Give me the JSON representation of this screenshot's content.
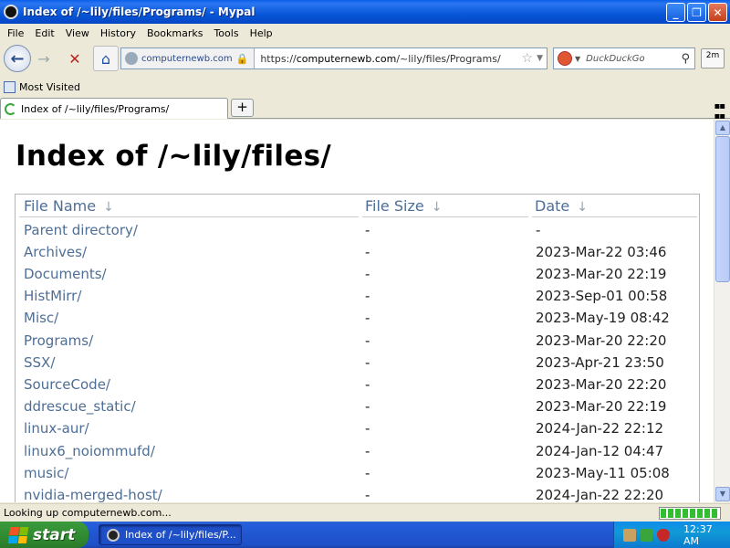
{
  "window": {
    "title": "Index of /~lily/files/Programs/ - Mypal",
    "min_label": "_",
    "max_label": "❐",
    "close_label": "✕"
  },
  "menu": [
    "File",
    "Edit",
    "View",
    "History",
    "Bookmarks",
    "Tools",
    "Help"
  ],
  "nav": {
    "site_identity": "computernewb.com",
    "url_prefix": "https://",
    "url_host": "computernewb.com",
    "url_path": "/~lily/files/Programs/",
    "search_placeholder": "DuckDuckGo",
    "timer_label": "2m"
  },
  "bookmarks": {
    "most_visited": "Most Visited"
  },
  "tab": {
    "label": "Index of /~lily/files/Programs/"
  },
  "page": {
    "heading": "Index of /~lily/files/",
    "columns": {
      "name": "File Name",
      "size": "File Size",
      "date": "Date",
      "sort_arrow": "↓"
    },
    "rows": [
      {
        "name": "Parent directory/",
        "size": "-",
        "date": "-"
      },
      {
        "name": "Archives/",
        "size": "-",
        "date": "2023-Mar-22 03:46"
      },
      {
        "name": "Documents/",
        "size": "-",
        "date": "2023-Mar-20 22:19"
      },
      {
        "name": "HistMirr/",
        "size": "-",
        "date": "2023-Sep-01 00:58"
      },
      {
        "name": "Misc/",
        "size": "-",
        "date": "2023-May-19 08:42"
      },
      {
        "name": "Programs/",
        "size": "-",
        "date": "2023-Mar-20 22:20"
      },
      {
        "name": "SSX/",
        "size": "-",
        "date": "2023-Apr-21 23:50"
      },
      {
        "name": "SourceCode/",
        "size": "-",
        "date": "2023-Mar-20 22:20"
      },
      {
        "name": "ddrescue_static/",
        "size": "-",
        "date": "2023-Mar-20 22:19"
      },
      {
        "name": "linux-aur/",
        "size": "-",
        "date": "2024-Jan-22 22:12"
      },
      {
        "name": "linux6_noiommufd/",
        "size": "-",
        "date": "2024-Jan-12 04:47"
      },
      {
        "name": "music/",
        "size": "-",
        "date": "2023-May-11 05:08"
      },
      {
        "name": "nvidia-merged-host/",
        "size": "-",
        "date": "2024-Jan-22 22:20"
      }
    ]
  },
  "status": {
    "text": "Looking up computernewb.com..."
  },
  "taskbar": {
    "start_label": "start",
    "task_label": "Index of /~lily/files/P...",
    "clock": "12:37 AM"
  },
  "colors": {
    "link": "#4e6e96",
    "titlebar": "#0757D9",
    "taskbar": "#245DDB",
    "start": "#2f8a2f"
  }
}
